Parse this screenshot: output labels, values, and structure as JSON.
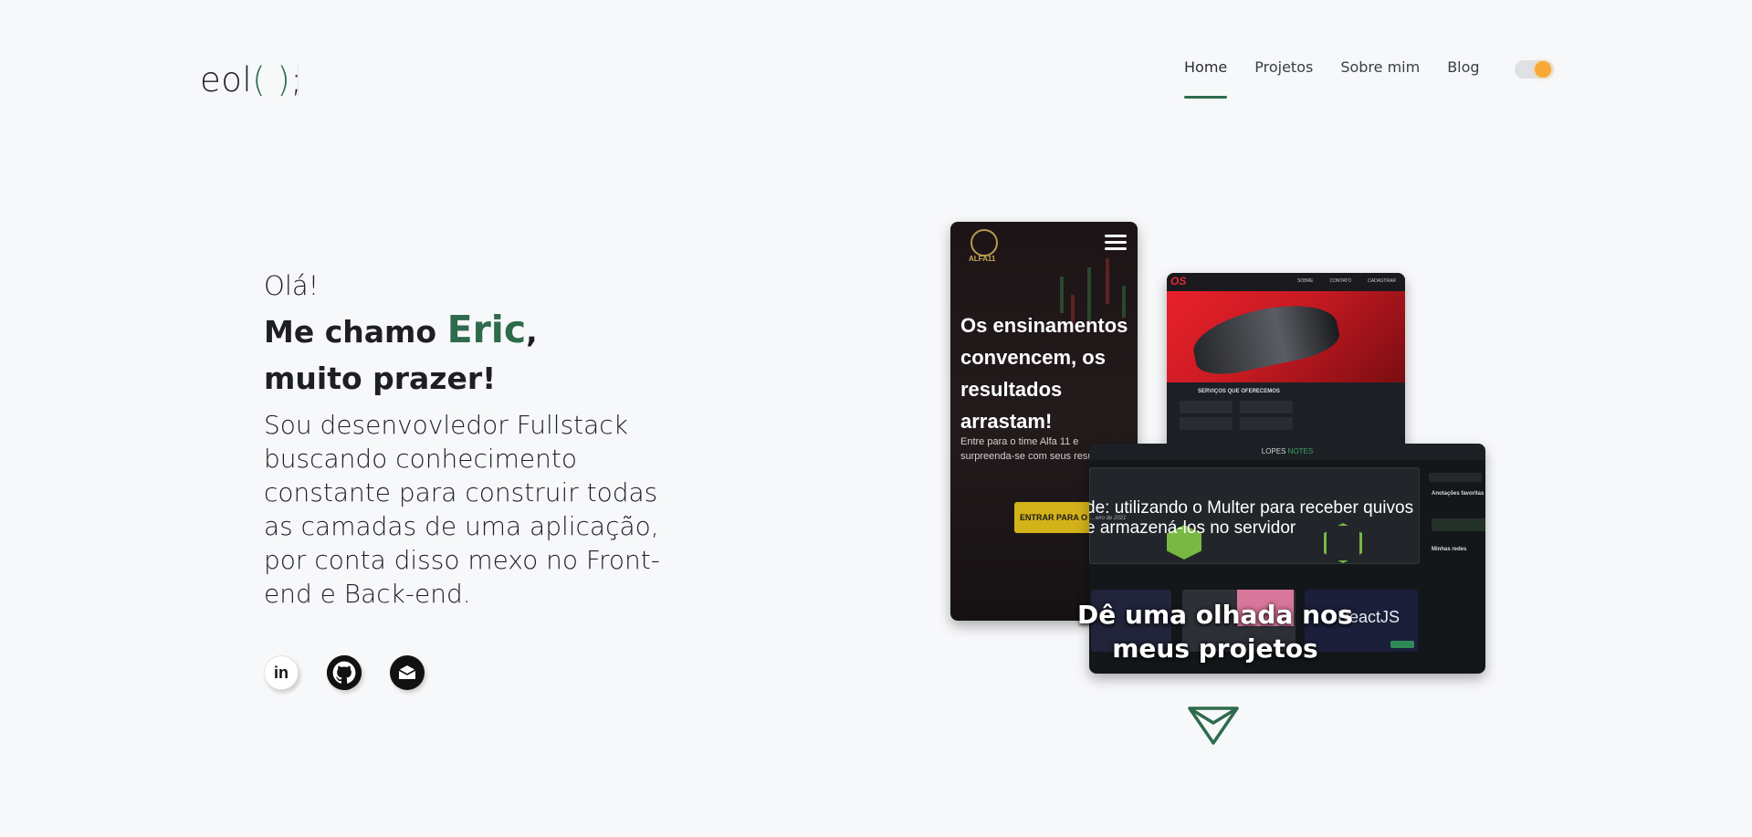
{
  "header": {
    "logo": {
      "text": "eol",
      "paren": "( )",
      "semi": ";"
    },
    "nav": [
      {
        "label": "Home",
        "active": true
      },
      {
        "label": "Projetos",
        "active": false
      },
      {
        "label": "Sobre mim",
        "active": false
      },
      {
        "label": "Blog",
        "active": false
      }
    ],
    "theme_toggle": {
      "state": "light",
      "icon": "sun-icon"
    }
  },
  "hero": {
    "greeting": "Olá!",
    "intro_prefix": "Me chamo ",
    "name": "Eric",
    "intro_suffix": ",",
    "intro_line2": "muito prazer!",
    "description": "Sou desenvovledor Fullstack buscando conhecimento constante para construir todas as camadas de uma aplicação, por conta disso mexo no Front-end e Back-end."
  },
  "socials": [
    {
      "name": "linkedin",
      "icon": "linkedin-icon",
      "glyph": "in"
    },
    {
      "name": "github",
      "icon": "github-icon"
    },
    {
      "name": "email",
      "icon": "email-icon"
    }
  ],
  "projects_preview": {
    "alfa": {
      "logo_text": "ALFA11",
      "headline": "Os ensinamentos convencem, os resultados arrastam!",
      "subtext": "Entre para o time Alfa 11 e surpreenda-se com seus resultados",
      "button": "ENTRAR PARA O TI"
    },
    "car": {
      "brand": "OS",
      "nav_links": [
        "SOBRE",
        "CONTATO",
        "CADASTRAR"
      ],
      "services_title": "SERVIÇOS QUE OFERECEMOS"
    },
    "notes": {
      "brand_left": "LOPES",
      "brand_right": "NOTES",
      "date": "…eiro de 2021",
      "article_title": "de: utilizando o Multer para receber quivos e armazená-los no servidor",
      "sidebar_fav": "Anotações favoritas",
      "sidebar_redes": "Minhas redes",
      "mini_label": "ReactJS"
    },
    "cta": "Dê uma olhada nos meus projetos"
  },
  "colors": {
    "accent": "#2e6b4c",
    "background": "#f7f8fa",
    "text": "#1e1f24"
  }
}
